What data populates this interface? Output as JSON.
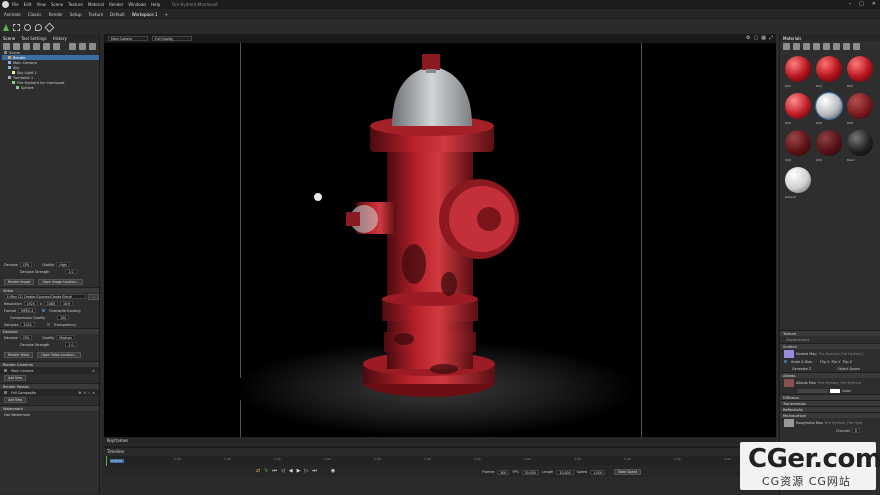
{
  "window": {
    "menu": [
      "File",
      "Edit",
      "View",
      "Scene",
      "Texture",
      "Material",
      "Render",
      "Windows",
      "Help",
      "Fire Hydrant.Marmoset"
    ],
    "document_title": "Fire Hydrant.Marmoset",
    "controls": [
      "–",
      "□",
      "✕"
    ]
  },
  "modes": [
    "Animate",
    "Classic",
    "Render",
    "Setup",
    "Texture",
    "Default",
    "Workspace 1",
    "+"
  ],
  "left_panel": {
    "tabs": [
      "Scene",
      "Tool Settings",
      "History"
    ],
    "tree": [
      "Scene",
      "Render",
      "Main Camera",
      "Sky",
      "Sky Light 1",
      "Turntable 1",
      "Fire Hydrant for marmoset",
      "Sphere"
    ],
    "render": {
      "denoise_label": "Denoise",
      "denoise_value": "CPU",
      "quality_label": "Quality",
      "quality_value": "High",
      "denoise_strength_label": "Denoise Strength",
      "denoise_strength_value": "1.0",
      "render_image": "Render Image",
      "open_image_location": "Open Image Location...",
      "video_header": "Video",
      "path": "E:/Rex CG Creator/Courses/Create Electri",
      "resolution_label": "Resolution",
      "res_w": "1920",
      "x": "x",
      "res_h": "1080",
      "res_extra": "16:9",
      "format_label": "Format",
      "format_value": "MPEG-4",
      "overwrite_existing": "Overwrite Existing",
      "compression_label": "Compression Quality",
      "compression_value": "100",
      "samples_label": "Samples",
      "samples_value": "1024",
      "transparency": "Transparency",
      "denoise_header": "Denoise",
      "denoise2_value": "CPU",
      "quality2_label": "Quality",
      "quality2_value": "Medium",
      "denoise2_strength_value": "1.0",
      "render_video": "Render Video",
      "open_video_location": "Open Video Location..."
    },
    "render_cameras_header": "Render Cameras",
    "camera_item": "Main Camera",
    "add_new_1": "Add New",
    "render_passes_header": "Render Passes",
    "pass_item": "Full Composite",
    "add_new_2": "Add New",
    "watermark_header": "Watermark",
    "use_watermark": "Use Watermark"
  },
  "viewport": {
    "camera_dropdown": "Main Camera",
    "quality_dropdown": "Full Quality"
  },
  "right_panel": {
    "tab": "Materials",
    "materials": [
      "R02",
      "R03",
      "R05",
      "R05",
      "R06",
      "R08",
      "SKN",
      "R09",
      "Basic",
      "Default"
    ],
    "sections": {
      "texture_header": "Texture",
      "displacement": "Displacement",
      "surface": "Surface",
      "normal_map": "Normal Map",
      "normal_file": "Fire Hydrant_Fire Hydrant_N",
      "scale_bias": "Scale & Bias",
      "flip_x": "Flip X",
      "flip_y": "Flip Y",
      "flip_z": "Flip Z",
      "generate_z": "Generate Z",
      "object_space": "Object Space",
      "albedo_header": "Albedo",
      "albedo_map": "Albedo Map",
      "albedo_file": "Fire Hydrant_Fire Hydrant",
      "color_label": "Color",
      "diffusion": "Diffusion",
      "transmission": "Transmission",
      "reflectivity": "Reflectivity",
      "microsurface": "Microsurface",
      "roughness_map": "Roughness Map",
      "roughness_file": "Fire Hydrant_Fire Hydr",
      "channel_label": "Channel",
      "channel_value": "R",
      "gloss_label": "Gloss"
    }
  },
  "timeline": {
    "keyframes_tab": "Keyframes",
    "timeline_tab": "Timeline",
    "current_time": "0:00.01",
    "ticks": [
      "0.00",
      "0.50",
      "1.00",
      "1.50",
      "2.00",
      "2.50",
      "3.00",
      "3.50",
      "4.00",
      "4.50",
      "5.00",
      "5.50",
      "6.00"
    ],
    "frames_label": "Frames",
    "frames_value": "300",
    "fps_label": "FPS",
    "fps_value": "30.000",
    "length_label": "Length",
    "length_value": "10.000",
    "speed_label": "Speed",
    "speed_value": "1.000",
    "bake_speed": "Bake Speed"
  },
  "watermark_overlay": {
    "line1": "CGer.com",
    "line2": "CG资源 CG网站"
  },
  "colors": {
    "accent_blue": "#3a6fa5",
    "hydrant_red": "#b8212a",
    "cap_silver": "#b9bcc0"
  }
}
